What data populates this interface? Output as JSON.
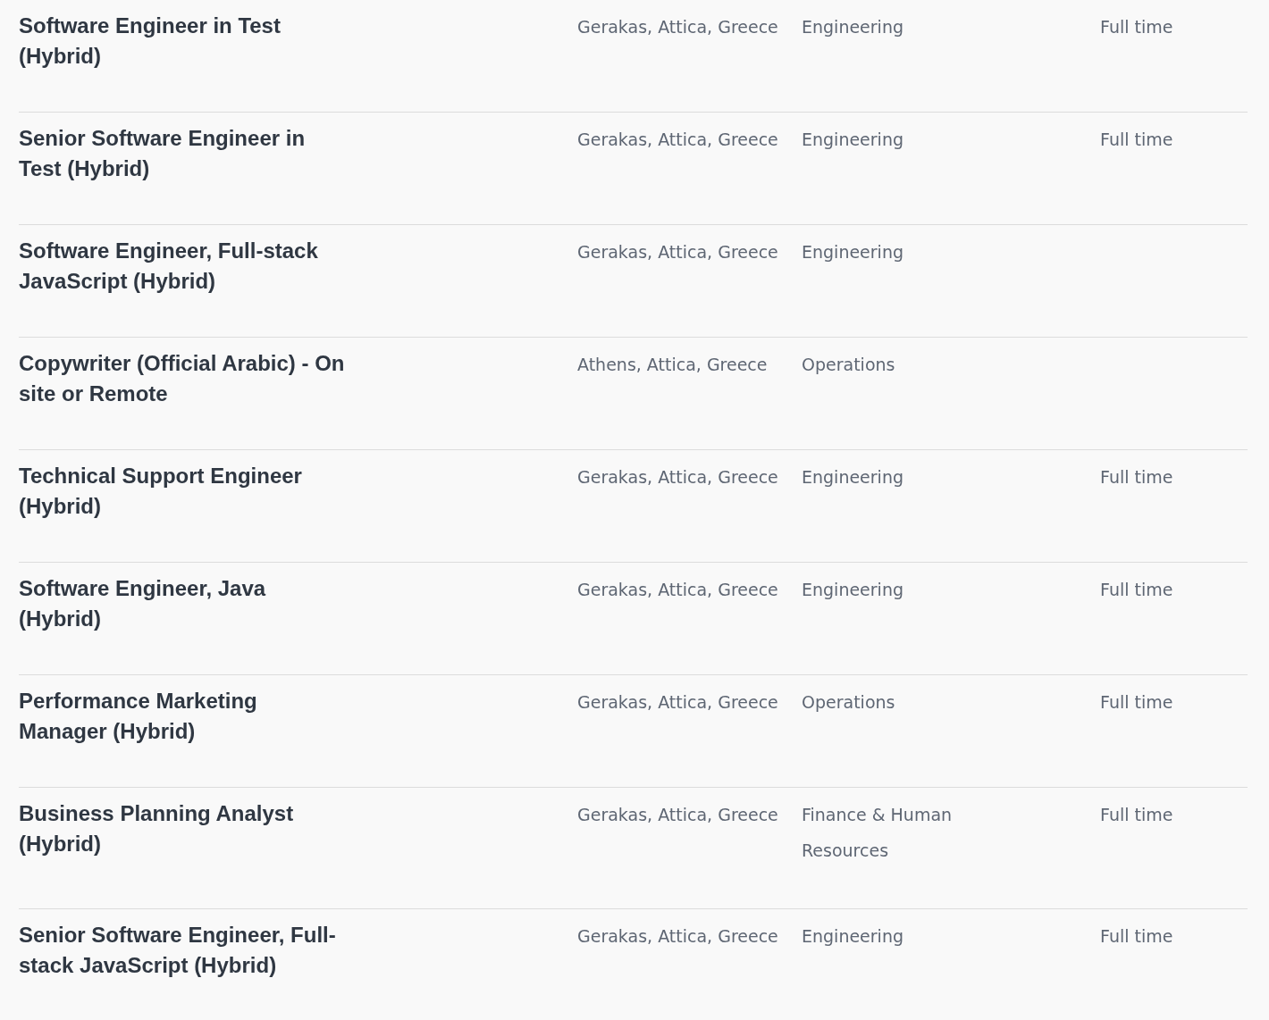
{
  "jobs": [
    {
      "title": "Software Engineer in Test (Hybrid)",
      "location": "Gerakas, Attica, Greece",
      "department": "Engineering",
      "type": "Full time"
    },
    {
      "title": "Senior Software Engineer in Test (Hybrid)",
      "location": "Gerakas, Attica, Greece",
      "department": "Engineering",
      "type": "Full time"
    },
    {
      "title": "Software Engineer, Full-stack JavaScript (Hybrid)",
      "location": "Gerakas, Attica, Greece",
      "department": "Engineering"
    },
    {
      "title": "Copywriter (Official Arabic) - On site or Remote",
      "location": "Athens, Attica, Greece",
      "department": "Operations"
    },
    {
      "title": "Technical Support Engineer (Hybrid)",
      "location": "Gerakas, Attica, Greece",
      "department": "Engineering",
      "type": "Full time"
    },
    {
      "title": "Software Engineer, Java (Hybrid)",
      "location": "Gerakas, Attica, Greece",
      "department": "Engineering",
      "type": "Full time"
    },
    {
      "title": "Performance Marketing Manager (Hybrid)",
      "location": "Gerakas, Attica, Greece",
      "department": "Operations",
      "type": "Full time"
    },
    {
      "title": "Business Planning Analyst (Hybrid)",
      "location": "Gerakas, Attica, Greece",
      "department": "Finance & Human Resources",
      "type": "Full time"
    },
    {
      "title": "Senior Software Engineer, Full-stack JavaScript (Hybrid)",
      "location": "Gerakas, Attica, Greece",
      "department": "Engineering",
      "type": "Full time"
    }
  ]
}
